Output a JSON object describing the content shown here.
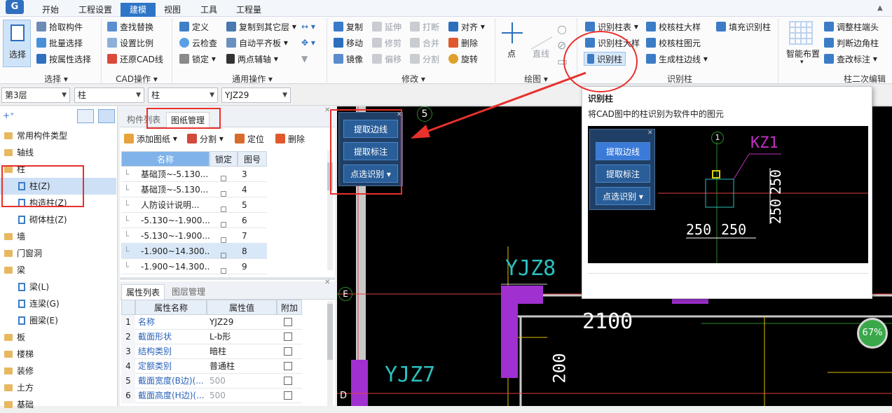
{
  "menu": {
    "tabs": [
      "开始",
      "工程设置",
      "建模",
      "视图",
      "工具",
      "工程量"
    ],
    "active": "建模",
    "app_letter": "G"
  },
  "ribbon": {
    "select": {
      "big": "选择",
      "pick": "拾取构件",
      "batch": "批量选择",
      "byattr": "按属性选择",
      "group": "选择"
    },
    "cad": {
      "find": "查找替换",
      "scale": "设置比例",
      "restore": "还原CAD线",
      "group": "CAD操作"
    },
    "common": {
      "define": "定义",
      "cloud": "云检查",
      "lock": "锁定",
      "copyto": "复制到其它层",
      "align": "自动平齐板",
      "twopoint": "两点辅轴",
      "group": "通用操作"
    },
    "modify": {
      "copy": "复制",
      "move": "移动",
      "mirror": "镜像",
      "extend": "延伸",
      "trim": "修剪",
      "offset": "偏移",
      "break": "打断",
      "merge": "合并",
      "split": "分割",
      "align": "对齐",
      "delete": "删除",
      "rotate": "旋转",
      "group": "修改"
    },
    "draw": {
      "point": "点",
      "line": "直线",
      "group": "绘图"
    },
    "identify": {
      "table": "识别柱表",
      "table_big": "识别柱大样",
      "col": "识别柱",
      "check_big": "校核柱大样",
      "check_elem": "校核柱图元",
      "gen_edge": "生成柱边线",
      "fill": "填充识别柱",
      "group": "识别柱"
    },
    "col2": {
      "smart": "智能布置",
      "adjust_head": "调整柱端头",
      "judge_corner": "判断边角柱",
      "edit_label": "查改标注",
      "group": "柱二次编辑"
    }
  },
  "toolbar2": {
    "floor": "第3层",
    "type1": "柱",
    "type2": "柱",
    "name": "YJZ29"
  },
  "tree": [
    {
      "label": "常用构件类型",
      "kind": "folder"
    },
    {
      "label": "轴线",
      "kind": "folder"
    },
    {
      "label": "柱",
      "kind": "folder"
    },
    {
      "label": "柱(Z)",
      "kind": "child",
      "selected": true
    },
    {
      "label": "构造柱(Z)",
      "kind": "child"
    },
    {
      "label": "砌体柱(Z)",
      "kind": "child"
    },
    {
      "label": "墙",
      "kind": "folder"
    },
    {
      "label": "门窗洞",
      "kind": "folder"
    },
    {
      "label": "梁",
      "kind": "folder"
    },
    {
      "label": "梁(L)",
      "kind": "child"
    },
    {
      "label": "连梁(G)",
      "kind": "child"
    },
    {
      "label": "圈梁(E)",
      "kind": "child"
    },
    {
      "label": "板",
      "kind": "folder"
    },
    {
      "label": "楼梯",
      "kind": "folder"
    },
    {
      "label": "装修",
      "kind": "folder"
    },
    {
      "label": "土方",
      "kind": "folder"
    },
    {
      "label": "基础",
      "kind": "folder"
    }
  ],
  "drawings": {
    "tabs": [
      "构件列表",
      "图纸管理"
    ],
    "toolbar": {
      "add": "添加图纸",
      "split": "分割",
      "locate": "定位",
      "delete": "删除"
    },
    "headers": [
      "名称",
      "锁定",
      "图号"
    ],
    "rows": [
      {
        "name": "基础顶~-5.130...",
        "num": "3"
      },
      {
        "name": "基础顶~-5.130...",
        "num": "4"
      },
      {
        "name": "人防设计说明...",
        "num": "5"
      },
      {
        "name": "-5.130~-1.900...",
        "num": "6"
      },
      {
        "name": "-5.130~-1.900...",
        "num": "7"
      },
      {
        "name": "-1.900~14.300...",
        "num": "8"
      },
      {
        "name": "-1.900~14.300...",
        "num": "9"
      }
    ]
  },
  "props": {
    "tabs": [
      "属性列表",
      "图层管理"
    ],
    "headers": [
      "属性名称",
      "属性值",
      "附加"
    ],
    "rows": [
      {
        "i": "1",
        "name": "名称",
        "value": "YJZ29"
      },
      {
        "i": "2",
        "name": "截面形状",
        "value": "L-b形"
      },
      {
        "i": "3",
        "name": "结构类别",
        "value": "暗柱"
      },
      {
        "i": "4",
        "name": "定额类别",
        "value": "普通柱"
      },
      {
        "i": "5",
        "name": "截面宽度(B边)(...",
        "value": "500"
      },
      {
        "i": "6",
        "name": "截面高度(H边)(...",
        "value": "500"
      }
    ]
  },
  "floating": {
    "extract_line": "提取边线",
    "extract_label": "提取标注",
    "point_identify": "点选识别"
  },
  "cad": {
    "axis5": "5",
    "axisE": "E",
    "axisD": "D",
    "yjz8": "YJZ8",
    "yjz7": "YJZ7",
    "dim2100": "2100",
    "dim200": "200"
  },
  "popup": {
    "title": "识别柱",
    "desc": "将CAD图中的柱识别为软件中的图元",
    "axis1": "1",
    "kz1": "KZ1",
    "d250a": "250",
    "d250b": "250",
    "d250c": "250",
    "d250d": "250"
  },
  "progress": {
    "value": "67%"
  }
}
